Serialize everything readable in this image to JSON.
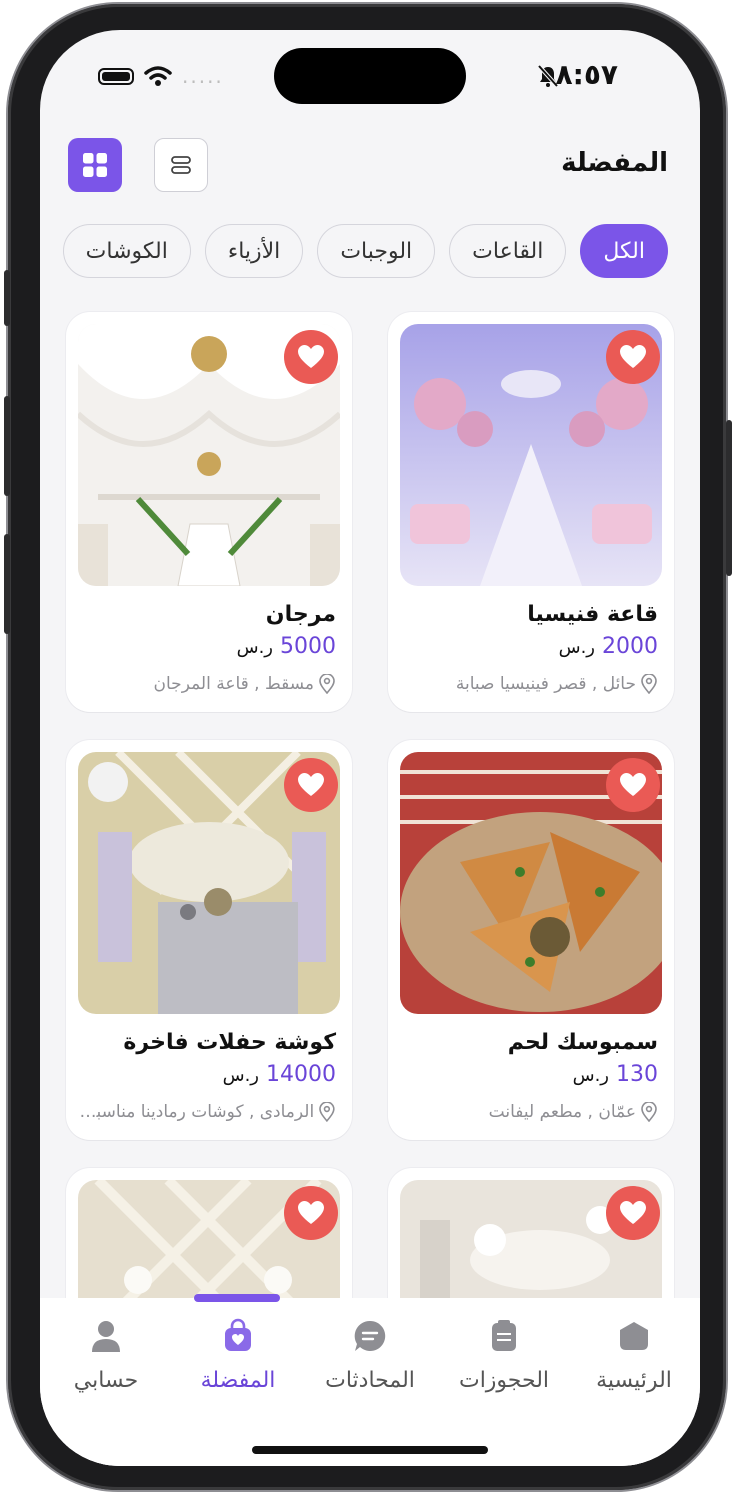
{
  "status_bar": {
    "time": "٨:٥٧",
    "signal_dots": "....."
  },
  "header": {
    "title": "المفضلة"
  },
  "chips": [
    "الكل",
    "القاعات",
    "الوجبات",
    "الأزياء",
    "الكوشات"
  ],
  "cards": [
    {
      "title": "قاعة فنيسيا",
      "price": "2000",
      "currency": "ر.س",
      "location": "حائل , قصر فينيسيا صبابة"
    },
    {
      "title": "مرجان",
      "price": "5000",
      "currency": "ر.س",
      "location": "مسقط , قاعة المرجان"
    },
    {
      "title": "سمبوسك لحم",
      "price": "130",
      "currency": "ر.س",
      "location": "عمّان , مطعم ليفانت"
    },
    {
      "title": "كوشة حفلات فاخرة",
      "price": "14000",
      "currency": "ر.س",
      "location": "الرمادى , كوشات رمادينا مناسبات"
    }
  ],
  "tabs": [
    "الرئيسية",
    "الحجوزات",
    "المحادثات",
    "المفضلة",
    "حسابي"
  ],
  "colors": {
    "accent": "#7b55e8",
    "heart": "#ea5a55",
    "background": "#f5f5f7"
  }
}
